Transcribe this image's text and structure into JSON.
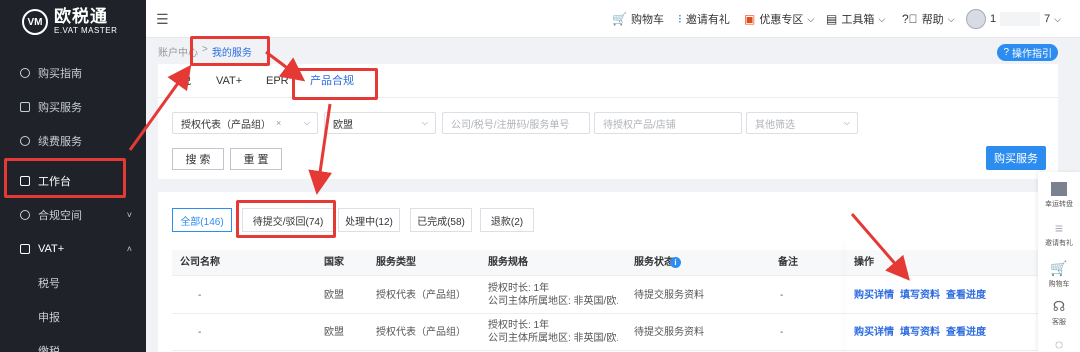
{
  "brand": {
    "cn": "欧税通",
    "en": "E.VAT MASTER",
    "mark": "VM"
  },
  "sidebar": {
    "items": [
      {
        "label": "购买指南"
      },
      {
        "label": "购买服务"
      },
      {
        "label": "续费服务"
      },
      {
        "label": "工作台"
      },
      {
        "label": "合规空间",
        "chevron": "˅"
      },
      {
        "label": "VAT+",
        "chevron": "˄"
      }
    ],
    "sub_items": [
      "税号",
      "申报",
      "缴税"
    ]
  },
  "topbar": {
    "collapse_icon": "☰",
    "cart": "购物车",
    "invite": "邀请有礼",
    "discount": "优惠专区",
    "toolbox": "工具箱",
    "help": "帮助",
    "user_prefix": "1",
    "user_suffix": "7"
  },
  "breadcrumb": {
    "root": "账户中心",
    "sep": ">",
    "current": "我的服务"
  },
  "guide_button": "操作指引",
  "service_tabs": [
    "税",
    "VAT+",
    "EPR",
    "产品合规"
  ],
  "filters": {
    "product_group": "授权代表（产品组）",
    "region": "欧盟",
    "search_placeholder": "公司/税号/注册码/服务单号",
    "authorize_placeholder": "待授权产品/店铺",
    "other_placeholder": "其他筛选",
    "search_button": "搜 索",
    "reset_button": "重 置",
    "buy_button": "购买服务"
  },
  "status_tabs": [
    "全部(146)",
    "待提交/驳回(74)",
    "处理中(12)",
    "已完成(58)",
    "退款(2)"
  ],
  "table": {
    "headers": [
      "公司名称",
      "国家",
      "服务类型",
      "服务规格",
      "服务状态",
      "备注",
      "操作"
    ],
    "rows": [
      {
        "company": "-",
        "country": "欧盟",
        "type": "授权代表（产品组）",
        "spec1": "授权时长: 1年",
        "spec2": "公司主体所属地区: 非英国/欧...",
        "status": "待提交服务资料",
        "note": "-",
        "actions": [
          "购买详情",
          "填写资料",
          "查看进度"
        ]
      },
      {
        "company": "-",
        "country": "欧盟",
        "type": "授权代表（产品组）",
        "spec1": "授权时长: 1年",
        "spec2": "公司主体所属地区: 非英国/欧...",
        "status": "待提交服务资料",
        "note": "-",
        "actions": [
          "购买详情",
          "填写资料",
          "查看进度"
        ]
      }
    ]
  },
  "floatbar": [
    "幸运转盘",
    "邀请有礼",
    "购物车",
    "客服"
  ],
  "annotation_color": "#e53935",
  "accent": "#2d8cf0"
}
